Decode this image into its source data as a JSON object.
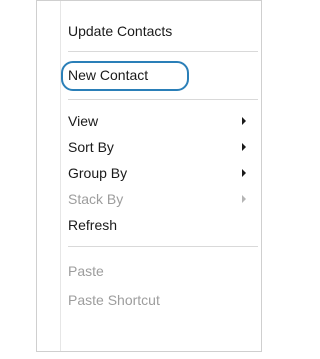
{
  "menu": {
    "items": [
      {
        "label": "Update Contacts",
        "disabled": false,
        "submenu": false
      },
      {
        "label": "New Contact",
        "disabled": false,
        "submenu": false,
        "circled": true
      },
      {
        "label": "View",
        "disabled": false,
        "submenu": true
      },
      {
        "label": "Sort By",
        "disabled": false,
        "submenu": true
      },
      {
        "label": "Group By",
        "disabled": false,
        "submenu": true
      },
      {
        "label": "Stack By",
        "disabled": true,
        "submenu": true
      },
      {
        "label": "Refresh",
        "disabled": false,
        "submenu": false
      },
      {
        "label": "Paste",
        "disabled": true,
        "submenu": false
      },
      {
        "label": "Paste Shortcut",
        "disabled": true,
        "submenu": false
      }
    ]
  },
  "colors": {
    "highlight_ring": "#2a7fb8",
    "disabled_text": "#9d9d9d"
  },
  "icons": {
    "submenu_arrow": "chevron-right-icon"
  }
}
